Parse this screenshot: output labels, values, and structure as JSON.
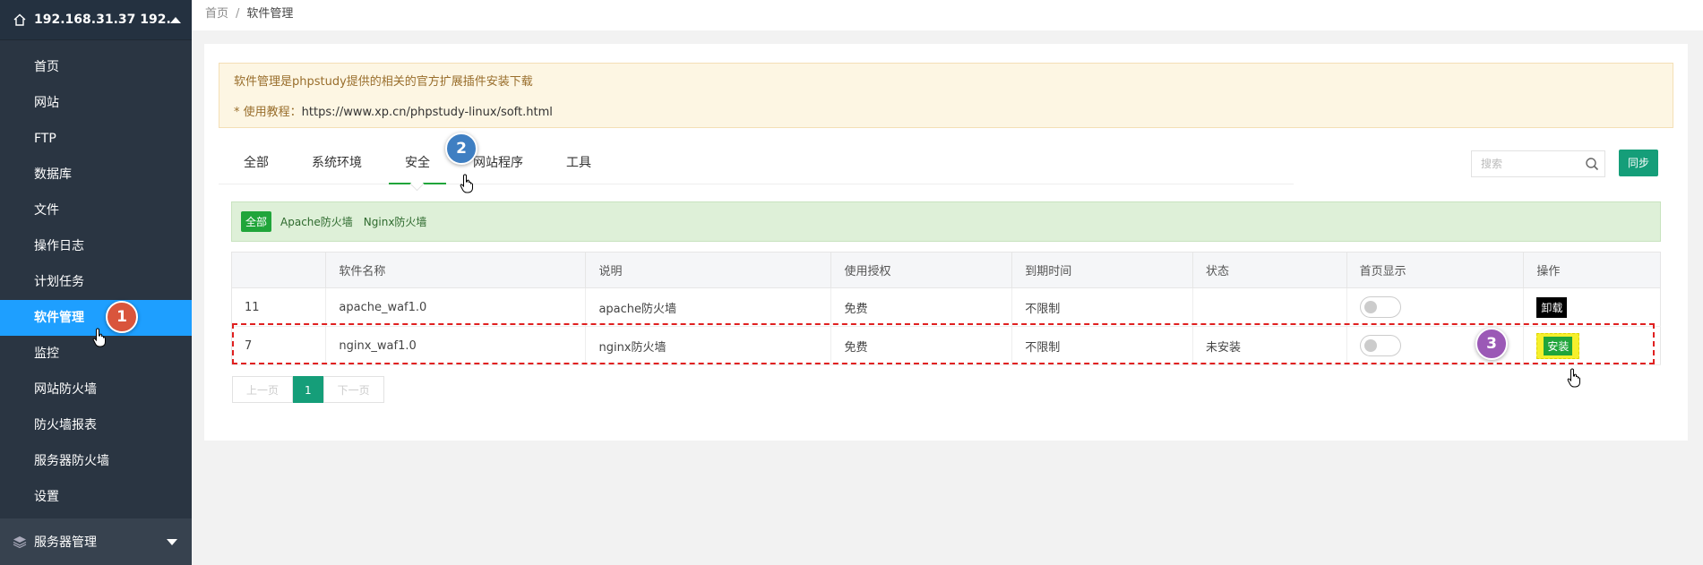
{
  "sidebar": {
    "host": "192.168.31.37 192.1...",
    "items": [
      {
        "label": "首页"
      },
      {
        "label": "网站"
      },
      {
        "label": "FTP"
      },
      {
        "label": "数据库"
      },
      {
        "label": "文件"
      },
      {
        "label": "操作日志"
      },
      {
        "label": "计划任务"
      },
      {
        "label": "软件管理"
      },
      {
        "label": "监控"
      },
      {
        "label": "网站防火墙"
      },
      {
        "label": "防火墙报表"
      },
      {
        "label": "服务器防火墙"
      },
      {
        "label": "设置"
      }
    ],
    "active_index": 7,
    "bottom": "服务器管理"
  },
  "breadcrumb": {
    "home": "首页",
    "sep": "/",
    "current": "软件管理"
  },
  "notice": {
    "line1": "软件管理是phpstudy提供的相关的官方扩展插件安装下载",
    "line2_prefix": "* 使用教程：",
    "line2_url": "https://www.xp.cn/phpstudy-linux/soft.html"
  },
  "tabs": [
    {
      "label": "全部"
    },
    {
      "label": "系统环境"
    },
    {
      "label": "安全"
    },
    {
      "label": "网站程序"
    },
    {
      "label": "工具"
    }
  ],
  "search": {
    "placeholder": "搜索"
  },
  "sync_label": "同步",
  "filter": {
    "all": "全部",
    "items": [
      "Apache防火墙",
      "Nginx防火墙"
    ]
  },
  "table": {
    "headers": [
      "",
      "软件名称",
      "说明",
      "使用授权",
      "到期时间",
      "状态",
      "首页显示",
      "操作"
    ],
    "rows": [
      {
        "id": "11",
        "name": "apache_waf1.0",
        "desc": "apache防火墙",
        "license": "免费",
        "expire": "不限制",
        "status": "",
        "action": "卸载"
      },
      {
        "id": "7",
        "name": "nginx_waf1.0",
        "desc": "nginx防火墙",
        "license": "免费",
        "expire": "不限制",
        "status": "未安装",
        "action": "安装"
      }
    ]
  },
  "pager": {
    "prev": "上一页",
    "current": "1",
    "next": "下一页"
  },
  "badges": [
    {
      "num": "1",
      "color": "#d9553c"
    },
    {
      "num": "2",
      "color": "#3f7fc2"
    },
    {
      "num": "3",
      "color": "#9b59b6"
    }
  ],
  "colors": {
    "sidebar_bg": "#2a3542",
    "active": "#1e9fff",
    "accent": "#20a53a",
    "sync": "#159e79"
  }
}
